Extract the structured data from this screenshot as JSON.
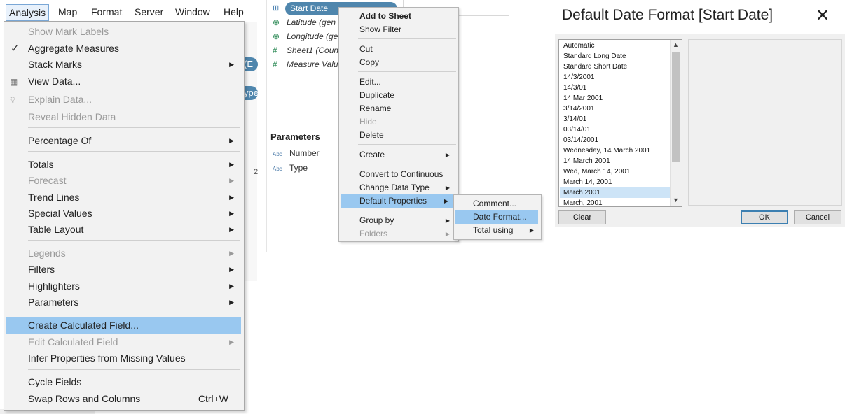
{
  "menubar": {
    "items": [
      {
        "label": "Analysis",
        "active": true
      },
      {
        "label": "Map"
      },
      {
        "label": "Format"
      },
      {
        "label": "Server"
      },
      {
        "label": "Window"
      },
      {
        "label": "Help"
      }
    ]
  },
  "analysis_menu": {
    "items": [
      {
        "label": "Show Mark Labels",
        "disabled": true
      },
      {
        "label": "Aggregate Measures",
        "checked": true
      },
      {
        "label": "Stack Marks",
        "submenu": true
      },
      {
        "label": "View Data...",
        "icon": "table-grid-icon"
      },
      {
        "label": "Explain Data...",
        "disabled": true,
        "icon": "lightbulb-icon"
      },
      {
        "label": "Reveal Hidden Data",
        "disabled": true
      },
      {
        "label": "Percentage Of",
        "submenu": true
      },
      {
        "label": "Totals",
        "submenu": true
      },
      {
        "label": "Forecast",
        "disabled": true,
        "submenu": true
      },
      {
        "label": "Trend Lines",
        "submenu": true
      },
      {
        "label": "Special Values",
        "submenu": true
      },
      {
        "label": "Table Layout",
        "submenu": true
      },
      {
        "label": "Legends",
        "disabled": true,
        "submenu": true
      },
      {
        "label": "Filters",
        "submenu": true
      },
      {
        "label": "Highlighters",
        "submenu": true
      },
      {
        "label": "Parameters",
        "submenu": true
      },
      {
        "label": "Create Calculated Field...",
        "highlighted": true
      },
      {
        "label": "Edit Calculated Field",
        "disabled": true,
        "submenu": true
      },
      {
        "label": "Infer Properties from Missing Values"
      },
      {
        "label": "Cycle Fields"
      },
      {
        "label": "Swap Rows and Columns",
        "shortcut": "Ctrl+W"
      }
    ]
  },
  "data_pane": {
    "selected_field": "Start Date",
    "fields": [
      {
        "label": "Latitude (gen",
        "icon": "globe-icon"
      },
      {
        "label": "Longitude (ge",
        "icon": "globe-icon"
      },
      {
        "label": "Sheet1 (Coun",
        "icon": "measure-hash-icon"
      },
      {
        "label": "Measure Valu",
        "icon": "measure-hash-icon"
      }
    ],
    "parameters_header": "Parameters",
    "parameters": [
      {
        "label": "Number",
        "type_badge": "Abc"
      },
      {
        "label": "Type",
        "type_badge": "Abc"
      }
    ],
    "partial_pill_1": "(E",
    "partial_pill_2": "ype",
    "partial_digit": "2"
  },
  "context_menu": {
    "items": [
      {
        "label": "Add to Sheet",
        "bold": true
      },
      {
        "label": "Show Filter"
      },
      {
        "label": "Cut"
      },
      {
        "label": "Copy"
      },
      {
        "label": "Edit..."
      },
      {
        "label": "Duplicate"
      },
      {
        "label": "Rename"
      },
      {
        "label": "Hide",
        "disabled": true
      },
      {
        "label": "Delete"
      },
      {
        "label": "Create",
        "submenu": true
      },
      {
        "label": "Convert to Continuous"
      },
      {
        "label": "Change Data Type",
        "submenu": true
      },
      {
        "label": "Default Properties",
        "submenu": true,
        "highlighted": true
      },
      {
        "label": "Group by",
        "submenu": true
      },
      {
        "label": "Folders",
        "submenu": true,
        "disabled": true
      }
    ]
  },
  "sub_menu": {
    "items": [
      {
        "label": "Comment..."
      },
      {
        "label": "Date Format...",
        "highlighted": true
      },
      {
        "label": "Total using",
        "submenu": true
      }
    ]
  },
  "dialog": {
    "title": "Default Date Format [Start Date]",
    "formats": [
      "Automatic",
      "Standard Long Date",
      "Standard Short Date",
      "14/3/2001",
      "14/3/01",
      "14 Mar 2001",
      "3/14/2001",
      "3/14/01",
      "03/14/01",
      "03/14/2001",
      "Wednesday, 14 March 2001",
      "14 March 2001",
      "Wed, March 14, 2001",
      "March 14, 2001",
      "March 2001",
      "March, 2001"
    ],
    "selected_format": "March 2001",
    "clear_label": "Clear",
    "ok_label": "OK",
    "cancel_label": "Cancel"
  },
  "colors": {
    "highlight": "#99c8f0",
    "list_selection": "#cde4f7",
    "pill": "#4f86ad",
    "menu_bg": "#f2f2f2"
  }
}
